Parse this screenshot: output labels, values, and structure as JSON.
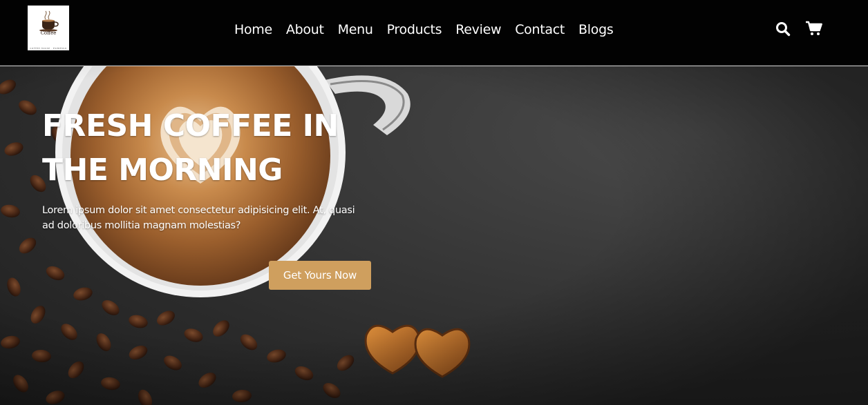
{
  "brand": {
    "logo_word": "Coffee",
    "logo_caption": "COFFEE HOUSE · ESPRESSO",
    "logo_icon": "coffee-cup-icon"
  },
  "nav": {
    "items": [
      {
        "label": "Home"
      },
      {
        "label": "About"
      },
      {
        "label": "Menu"
      },
      {
        "label": "Products"
      },
      {
        "label": "Review"
      },
      {
        "label": "Contact"
      },
      {
        "label": "Blogs"
      }
    ],
    "search_icon": "search-icon",
    "cart_icon": "shopping-cart-icon"
  },
  "hero": {
    "title_line1": "FRESH COFFEE IN",
    "title_line2": "THE MORNING",
    "text_line1": "Lorem ipsum dolor sit amet consectetur adipisicing elit. At, quasi",
    "text_line2": "ad doloribus mollitia magnam molestias?",
    "cta_label": "Get Yours Now",
    "background_image": "coffee-cup-with-heart-latte-art-and-beans"
  },
  "colors": {
    "header_bg": "#020202",
    "accent": "#cf9f5e",
    "text": "#ffffff",
    "hero_bg": "#2e2e2e"
  }
}
